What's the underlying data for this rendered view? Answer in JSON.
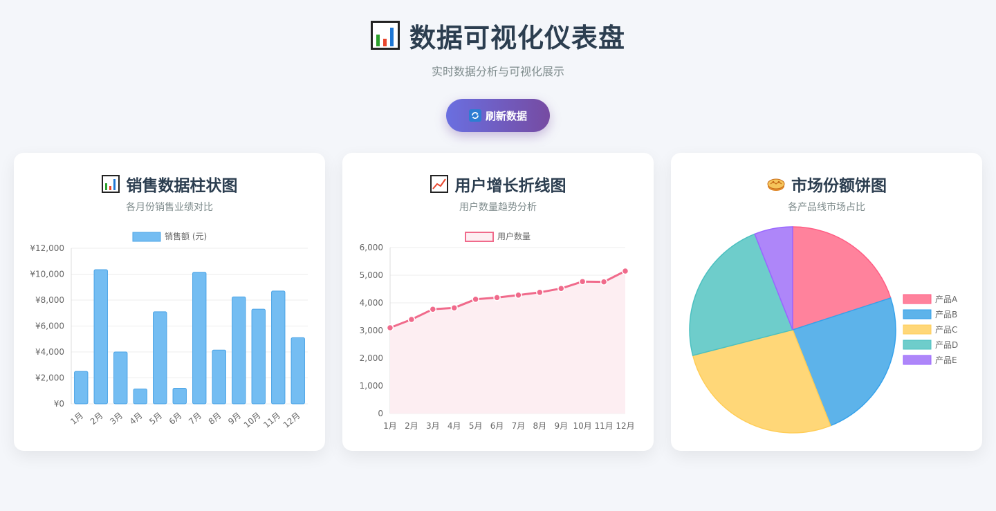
{
  "header": {
    "title": "数据可视化仪表盘",
    "subtitle": "实时数据分析与可视化展示",
    "refresh_label": "刷新数据"
  },
  "colors": {
    "bar_fill": "#74bdf2",
    "bar_stroke": "#4aa3e6",
    "line": "#f06a8b",
    "line_fill": "#fdeef2",
    "pie": [
      "#ff829c",
      "#5db3ea",
      "#ffd778",
      "#6ecdcb",
      "#ae86f9"
    ],
    "pie_stroke": [
      "#ff5d84",
      "#36a2eb",
      "#ffcd57",
      "#4bc0c0",
      "#9966ff"
    ]
  },
  "cards": {
    "bar": {
      "title": "销售数据柱状图",
      "subtitle": "各月份销售业绩对比",
      "icon": "bar-chart-icon"
    },
    "line": {
      "title": "用户增长折线图",
      "subtitle": "用户数量趋势分析",
      "icon": "line-chart-icon"
    },
    "pie": {
      "title": "市场份额饼图",
      "subtitle": "各产品线市场占比",
      "icon": "pie-icon"
    }
  },
  "chart_data": [
    {
      "type": "bar",
      "categories": [
        "1月",
        "2月",
        "3月",
        "4月",
        "5月",
        "6月",
        "7月",
        "8月",
        "9月",
        "10月",
        "11月",
        "12月"
      ],
      "series": [
        {
          "name": "销售额 (元)",
          "values": [
            2500,
            10350,
            4000,
            1150,
            7100,
            1200,
            10150,
            4150,
            8250,
            7300,
            8700,
            5100
          ]
        }
      ],
      "ylim": [
        0,
        12000
      ],
      "yticks": [
        "¥0",
        "¥2,000",
        "¥4,000",
        "¥6,000",
        "¥8,000",
        "¥10,000",
        "¥12,000"
      ],
      "legend": "top"
    },
    {
      "type": "area",
      "categories": [
        "1月",
        "2月",
        "3月",
        "4月",
        "5月",
        "6月",
        "7月",
        "8月",
        "9月",
        "10月",
        "11月",
        "12月"
      ],
      "series": [
        {
          "name": "用户数量",
          "values": [
            3100,
            3400,
            3770,
            3820,
            4130,
            4190,
            4280,
            4380,
            4520,
            4770,
            4760,
            5150
          ]
        }
      ],
      "ylim": [
        0,
        6000
      ],
      "yticks": [
        "0",
        "1,000",
        "2,000",
        "3,000",
        "4,000",
        "5,000",
        "6,000"
      ],
      "legend": "top"
    },
    {
      "type": "pie",
      "categories": [
        "产品A",
        "产品B",
        "产品C",
        "产品D",
        "产品E"
      ],
      "values": [
        20,
        24,
        27,
        23,
        6
      ],
      "legend": "right"
    }
  ]
}
